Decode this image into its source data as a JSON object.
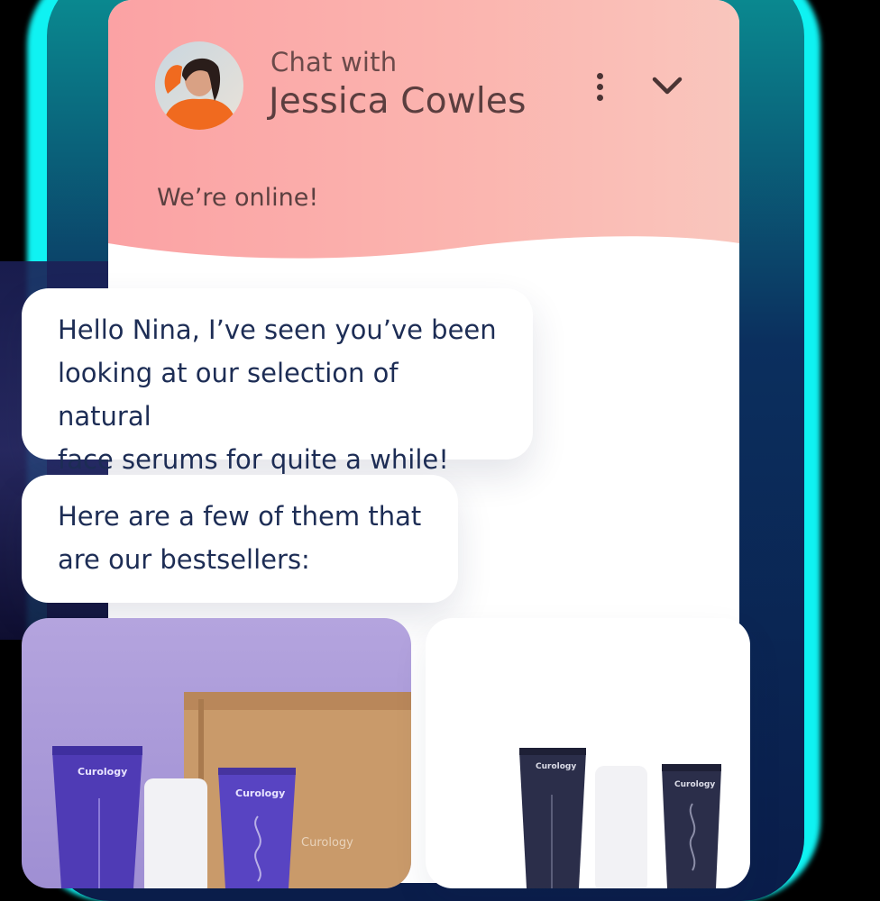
{
  "header": {
    "subtitle": "Chat with",
    "agent_name": "Jessica Cowles",
    "status": "We’re online!"
  },
  "messages": [
    {
      "text_lines": [
        "Hello Nina, I’ve seen you’ve been",
        "looking at our selection of natural",
        "face serums for quite a while!"
      ]
    },
    {
      "text_lines": [
        "Here are a few of them that",
        "are our bestsellers:"
      ]
    }
  ],
  "products": {
    "card1": {
      "brand_labels": [
        "Curology",
        "Curology",
        "Curology"
      ]
    },
    "card2": {
      "brand_labels": [
        "Curology",
        "Curology"
      ]
    }
  },
  "colors": {
    "header_start": "#fba2a4",
    "header_end": "#f9c6bd",
    "message_text": "#1d2d55",
    "glow": "#0ff2f2",
    "card1_bg": "#a898d8"
  },
  "icons": {
    "menu": "vertical-dots-icon",
    "collapse": "chevron-down-icon"
  }
}
